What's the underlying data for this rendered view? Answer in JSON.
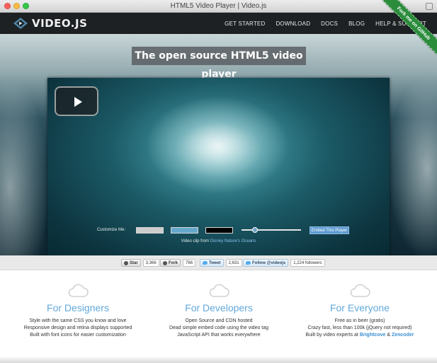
{
  "window": {
    "title": "HTML5 Video Player | Video.js"
  },
  "header": {
    "logo_text": "VIDEO.JS",
    "nav": [
      "GET STARTED",
      "DOWNLOAD",
      "DOCS",
      "BLOG",
      "HELP & SUPPORT"
    ],
    "ribbon": "Fork me on GitHub"
  },
  "hero": {
    "tagline": "The open source HTML5 video player",
    "customize_label": "Customize Me:",
    "swatches": {
      "base": "#cccccc",
      "accent": "#66a8cc",
      "background": "#000000"
    },
    "slider_level": 0.2,
    "embed_button": "Embed This Player",
    "clip_prefix": "Video clip from",
    "clip_link": "Disney Nature's Oceans"
  },
  "social": {
    "star_label": "Star",
    "star_count": "3,366",
    "fork_label": "Fork",
    "fork_count": "766",
    "tweet_label": "Tweet",
    "tweet_count": "2,631",
    "follow_label": "Follow @videojs",
    "follow_count": "1,224 followers"
  },
  "features": [
    {
      "title": "For Designers",
      "lines": [
        "Style with the same CSS you know and love",
        "Responsive design and retina displays supported",
        "Built with font icons for easier customization"
      ]
    },
    {
      "title": "For Developers",
      "lines": [
        "Open Source and CDN hosted",
        "Dead simple embed code using the video tag",
        "JavaScript API that works everywhere"
      ]
    },
    {
      "title": "For Everyone",
      "lines": [
        "Free as in beer (gratis)",
        "Crazy fast, less than 100k (jQuery not required)"
      ],
      "last_prefix": "Built by video experts at",
      "link1": "Brightcove",
      "amp": "&",
      "link2": "Zencoder"
    }
  ],
  "colors": {
    "accent": "#62a8dc",
    "header_bg": "#1e2124",
    "ribbon": "#2b8c3c",
    "embed_button": "#5e9bd0"
  }
}
